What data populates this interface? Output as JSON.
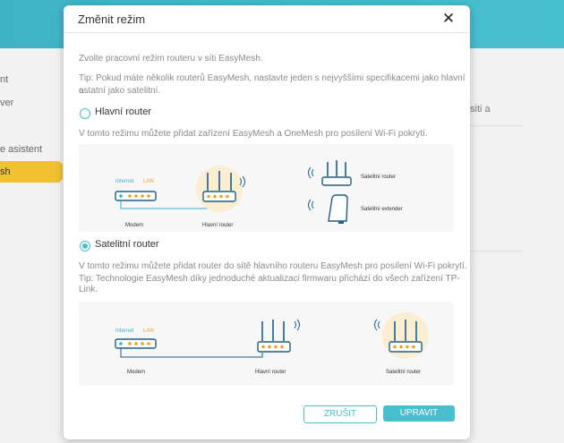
{
  "background": {
    "nav_items": [
      "nt",
      "ver",
      "e asistent",
      "sh"
    ],
    "right_text": "siti a"
  },
  "modal": {
    "title": "Změnit režim",
    "close_glyph": "✕",
    "intro": "Zvolte pracovní režim routeru v síti EasyMesh.",
    "tip_lines": [
      "Tip: Pokud máte několik routerů EasyMesh, nastavte jeden s nejvyššími specifikacemi jako hlavní a",
      "ostatní jako satelitní."
    ],
    "modes": [
      {
        "label": "Hlavní router",
        "checked": false,
        "description_lines": [
          "V tomto režimu můžete přidat zařízení EasyMesh a OneMesh pro posílení Wi-Fi pokrytí."
        ],
        "diagram": {
          "internet": "Internet",
          "lan": "LAN",
          "modem": "Modem",
          "router": "Hlavní router",
          "satellite_router": "Satelitní router",
          "satellite_extender": "Satelitní extender"
        }
      },
      {
        "label": "Satelitní router",
        "checked": true,
        "description_lines": [
          "V tomto režimu můžete přidat router do sítě hlavního routeru EasyMesh pro posílení Wi-Fi pokrytí.",
          "Tip: Technologie EasyMesh díky jednoduché aktualizaci firmwaru přichází do všech zařízení TP-",
          "Link."
        ],
        "diagram": {
          "internet": "Internet",
          "lan": "LAN",
          "modem": "Modem",
          "router": "Hlavní router",
          "satellite_router": "Satelitní router"
        }
      }
    ],
    "buttons": {
      "cancel": "ZRUŠIT",
      "ok": "UPRAVIT"
    }
  },
  "colors": {
    "accent": "#48bfcf",
    "nav_active": "#f0c232",
    "highlight": "#fbeed2"
  }
}
